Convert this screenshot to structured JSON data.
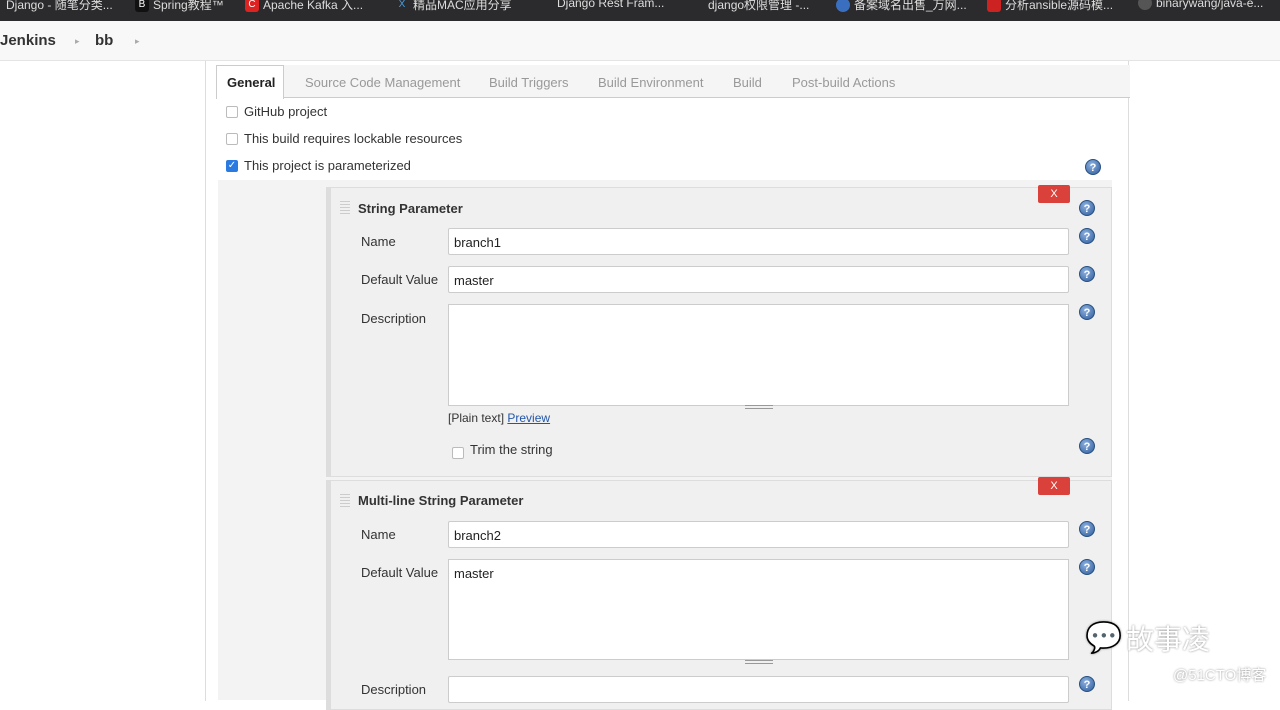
{
  "bookmarks": [
    "Django - 随笔分类...",
    "Spring教程™",
    "Apache Kafka 入...",
    "精品MAC应用分享",
    "Django Rest Fram...",
    "django权限管理 -...",
    "备案域名出售_万网...",
    "分析ansible源码模...",
    "binarywang/java-e..."
  ],
  "breadcrumb": [
    "Jenkins",
    "bb"
  ],
  "tabs": [
    "General",
    "Source Code Management",
    "Build Triggers",
    "Build Environment",
    "Build",
    "Post-build Actions"
  ],
  "options": [
    {
      "label": "GitHub project",
      "checked": false
    },
    {
      "label": "This build requires lockable resources",
      "checked": false
    },
    {
      "label": "This project is parameterized",
      "checked": true
    }
  ],
  "params": [
    {
      "title": "String Parameter",
      "delete": "X",
      "name_label": "Name",
      "name": "branch1",
      "default_label": "Default Value",
      "default": "master",
      "desc_label": "Description",
      "desc": "",
      "plain": "[Plain text]",
      "preview": "Preview",
      "trim": "Trim the string"
    },
    {
      "title": "Multi-line String Parameter",
      "delete": "X",
      "name_label": "Name",
      "name": "branch2",
      "default_label": "Default Value",
      "default": "master",
      "desc_label": "Description"
    }
  ],
  "help": "?",
  "watermark": {
    "name": "故事凌",
    "site": "@51CTO博客"
  }
}
